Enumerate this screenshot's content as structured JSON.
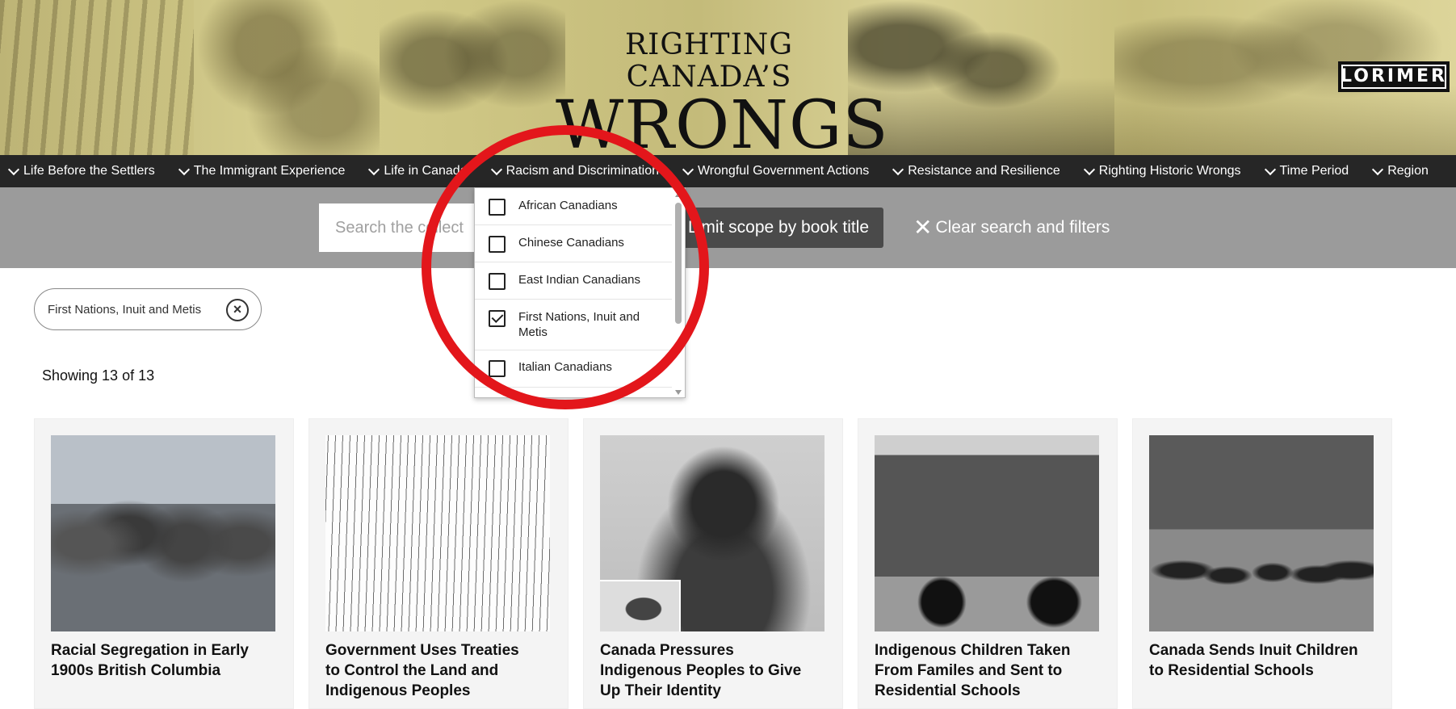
{
  "header": {
    "title_line1": "RIGHTING CANADA’S",
    "title_line2": "WRONGS",
    "publisher": "LORIMER"
  },
  "nav": {
    "items": [
      {
        "label": "Life Before the Settlers"
      },
      {
        "label": "The Immigrant Experience"
      },
      {
        "label": "Life in Canada"
      },
      {
        "label": "Racism and Discrimination"
      },
      {
        "label": "Wrongful Government Actions"
      },
      {
        "label": "Resistance and Resilience"
      },
      {
        "label": "Righting Historic Wrongs"
      },
      {
        "label": "Time Period"
      },
      {
        "label": "Region"
      }
    ]
  },
  "search": {
    "placeholder": "Search the collection",
    "scope_label": "Limit scope by book title",
    "clear_label": "Clear search and filters"
  },
  "dropdown": {
    "options": [
      {
        "label": "African Canadians",
        "checked": false
      },
      {
        "label": "Chinese Canadians",
        "checked": false
      },
      {
        "label": "East Indian Canadians",
        "checked": false
      },
      {
        "label": "First Nations, Inuit and Metis",
        "checked": true
      },
      {
        "label": "Italian Canadians",
        "checked": false
      }
    ]
  },
  "filters": {
    "active_chip": "First Nations, Inuit and Metis"
  },
  "results": {
    "showing": "Showing 13 of 13"
  },
  "cards": [
    {
      "title": "Racial Segregation in Early 1900s British Columbia"
    },
    {
      "title": "Government Uses Treaties to Control the Land and Indigenous Peoples"
    },
    {
      "title": "Canada Pressures Indigenous Peoples to Give Up Their Identity"
    },
    {
      "title": "Indigenous Children Taken From Familes and Sent to Residential Schools"
    },
    {
      "title": "Canada Sends Inuit Children to Residential Schools"
    }
  ],
  "colors": {
    "nav_bg": "#262626",
    "search_band": "#9b9b9b",
    "annotation": "#e3161b"
  }
}
